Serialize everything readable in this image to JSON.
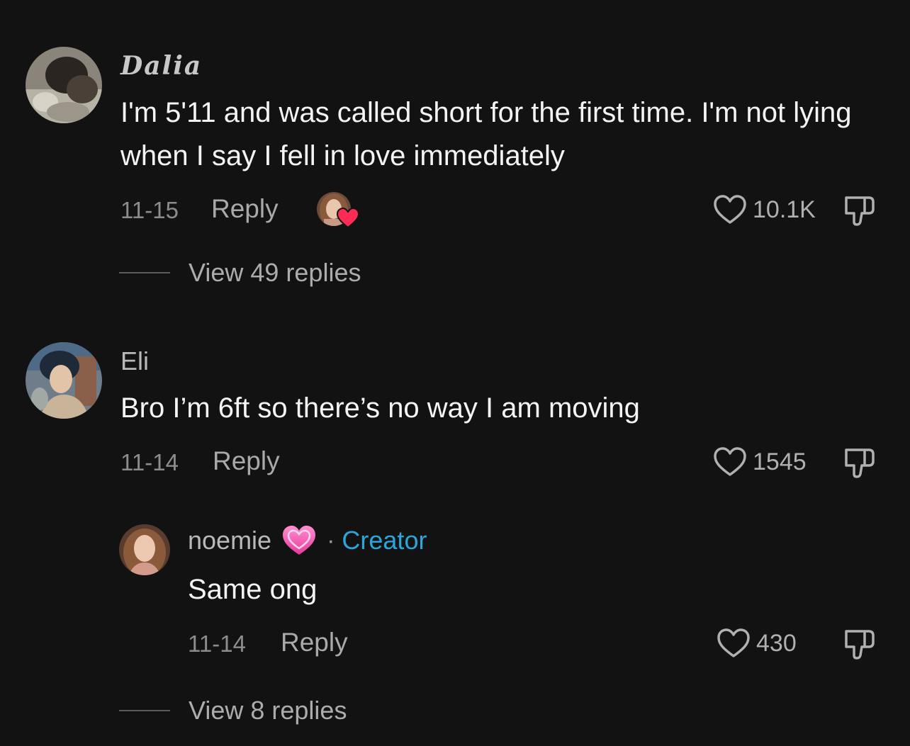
{
  "comments": [
    {
      "username": "Dalia",
      "text": "I'm 5'11 and was called short for the first time. I'm not lying when I say I fell in love immediately",
      "date": "11-15",
      "reply_label": "Reply",
      "likes": "10.1K",
      "liked_by_creator": true,
      "view_replies": "View 49 replies"
    },
    {
      "username": "Eli",
      "text": "Bro I’m 6ft so there’s no way I am moving",
      "date": "11-14",
      "reply_label": "Reply",
      "likes": "1545",
      "replies": [
        {
          "username": "noemie",
          "username_emoji": "pink-heart-icon",
          "separator": "·",
          "badge": "Creator",
          "text": "Same ong",
          "date": "11-14",
          "reply_label": "Reply",
          "likes": "430"
        }
      ],
      "view_replies": "View 8 replies"
    }
  ],
  "colors": {
    "background": "#121212",
    "creator_badge": "#2aa6d8",
    "heart_badge": "#fe2c55"
  }
}
